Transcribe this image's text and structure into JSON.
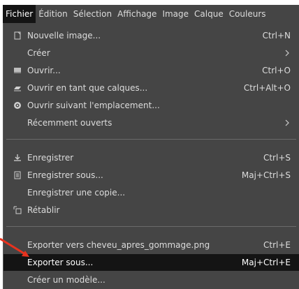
{
  "menubar": {
    "items": [
      {
        "label": "Fichier",
        "active": true
      },
      {
        "label": "Édition",
        "active": false
      },
      {
        "label": "Sélection",
        "active": false
      },
      {
        "label": "Affichage",
        "active": false
      },
      {
        "label": "Image",
        "active": false
      },
      {
        "label": "Calque",
        "active": false
      },
      {
        "label": "Couleurs",
        "active": false
      }
    ]
  },
  "file_menu": {
    "items": [
      {
        "label": "Nouvelle image...",
        "shortcut": "Ctrl+N",
        "icon": "new-image-icon"
      },
      {
        "label": "Créer",
        "shortcut": "",
        "icon": "",
        "submenu": true
      },
      {
        "label": "Ouvrir...",
        "shortcut": "Ctrl+O",
        "icon": "open-icon"
      },
      {
        "label": "Ouvrir en tant que calques...",
        "shortcut": "Ctrl+Alt+O",
        "icon": "open-as-layers-icon"
      },
      {
        "label": "Ouvrir suivant l'emplacement...",
        "shortcut": "",
        "icon": "open-location-icon"
      },
      {
        "label": "Récemment ouverts",
        "shortcut": "",
        "icon": "",
        "submenu": true
      },
      {
        "label": "Enregistrer",
        "shortcut": "Ctrl+S",
        "icon": "save-icon"
      },
      {
        "label": "Enregistrer sous...",
        "shortcut": "Maj+Ctrl+S",
        "icon": "save-as-icon"
      },
      {
        "label": "Enregistrer une copie...",
        "shortcut": "",
        "icon": ""
      },
      {
        "label": "Rétablir",
        "shortcut": "",
        "icon": "revert-icon"
      },
      {
        "label": "Exporter vers cheveu_apres_gommage.png",
        "shortcut": "Ctrl+E",
        "icon": ""
      },
      {
        "label": "Exporter sous...",
        "shortcut": "Maj+Ctrl+E",
        "icon": "",
        "highlighted": true
      },
      {
        "label": "Créer un modèle...",
        "shortcut": "",
        "icon": ""
      }
    ]
  },
  "colors": {
    "menu_bg": "#454545",
    "highlight_bg": "#141414",
    "text": "#dcdcdc",
    "annotation_arrow": "#e8321e"
  }
}
